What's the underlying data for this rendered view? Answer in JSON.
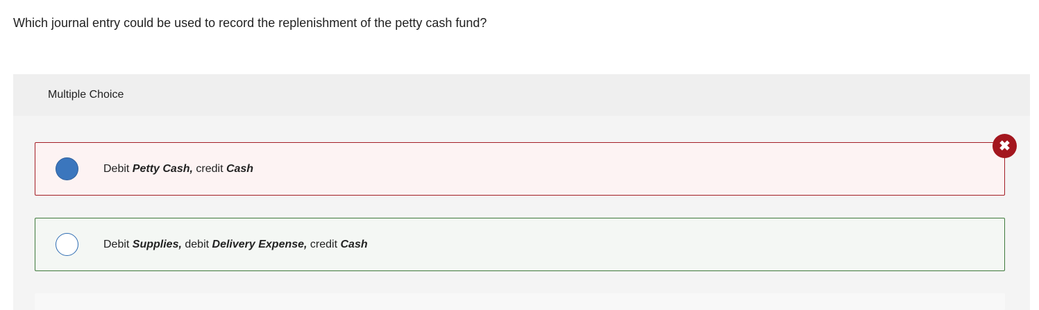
{
  "question": {
    "text": "Which journal entry could be used to record the replenishment of the petty cash fund?"
  },
  "panel": {
    "header": "Multiple Choice",
    "status_icon": "close-x-icon"
  },
  "options": [
    {
      "state": "selected-incorrect",
      "parts": [
        "Debit ",
        "Petty Cash,",
        " credit ",
        "Cash"
      ]
    },
    {
      "state": "correct-answer",
      "parts": [
        "Debit ",
        "Supplies,",
        " debit ",
        "Delivery Expense,",
        " credit ",
        "Cash"
      ]
    }
  ],
  "colors": {
    "incorrect_border": "#a31d25",
    "incorrect_bg": "#fdf3f3",
    "correct_border": "#3f7a3c",
    "correct_bg": "#f4f7f4",
    "selected_radio": "#3b76bd",
    "badge": "#a3161e"
  }
}
